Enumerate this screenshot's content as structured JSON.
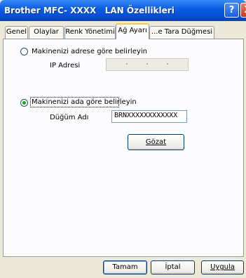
{
  "window": {
    "title": "Brother MFC- XXXX   LAN Özellikleri",
    "help_label": "?",
    "close_label": "X"
  },
  "tabs": [
    {
      "label": "Genel"
    },
    {
      "label": "Olaylar"
    },
    {
      "label": "Renk Yönetimi"
    },
    {
      "label": "Ağ Ayarı",
      "active": true
    },
    {
      "label": "...e Tara Düğmesi"
    }
  ],
  "address_option": {
    "label": "Makinenizi adrese göre belirleyin",
    "selected": false,
    "ip_label": "IP Adresi"
  },
  "name_option": {
    "label": "Makinenizi ada göre belirleyin",
    "selected": true,
    "node_label": "Düğüm Adı",
    "node_value": "BRNXXXXXXXXXXXX"
  },
  "browse_button": {
    "label": "Gözat"
  },
  "footer": {
    "ok_label": "Tamam",
    "cancel_label": "İptal",
    "apply_label": "Uygula"
  }
}
